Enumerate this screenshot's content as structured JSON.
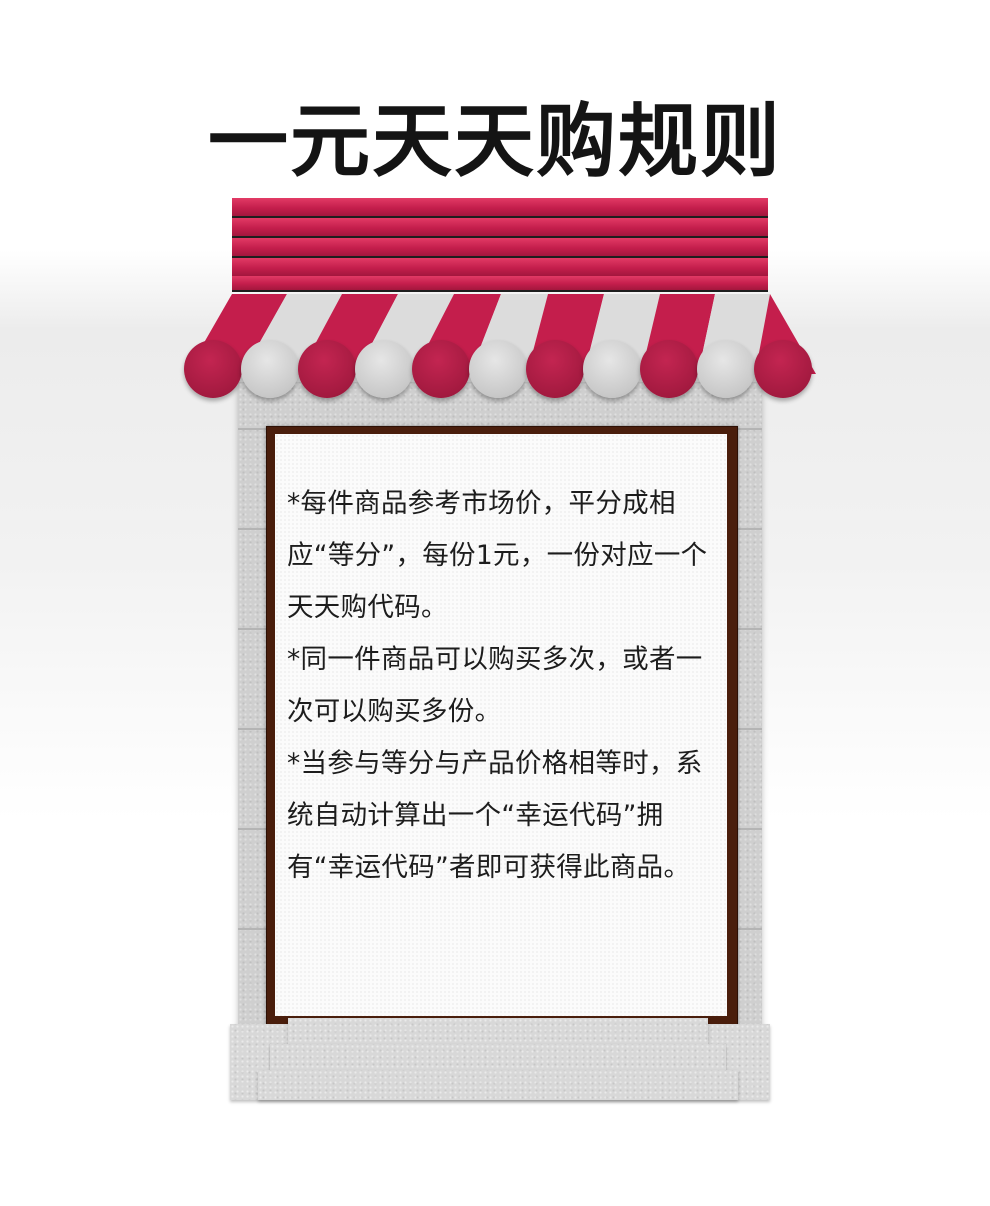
{
  "title": "一元天天购规则",
  "rules": [
    "*每件商品参考市场价，平分成相应“等分”，每份1元，一份对应一个天天购代码。",
    "*同一件商品可以购买多次，或者一次可以购买多份。",
    "*当参与等分与产品价格相等时，系统自动计算出一个“幸运代码”拥有“幸运代码”者即可获得此商品。"
  ],
  "colors": {
    "awning_red": "#c41e4c",
    "awning_grey": "#d6d6d6",
    "frame_brown": "#4a1e0c",
    "wall_grey": "#cfcfcf"
  }
}
